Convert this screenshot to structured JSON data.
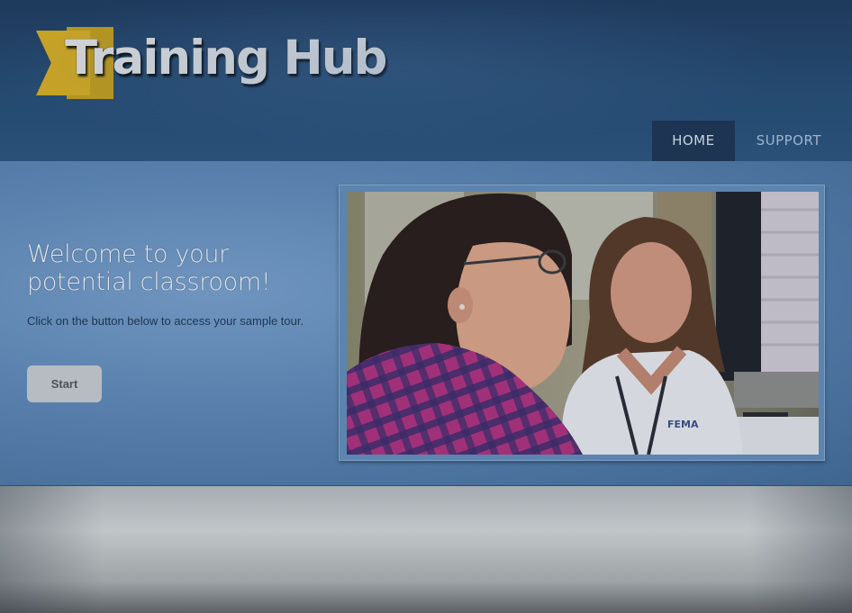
{
  "header": {
    "logo_text": "Training Hub",
    "nav": [
      {
        "label": "HOME",
        "active": true
      },
      {
        "label": "SUPPORT",
        "active": false
      }
    ]
  },
  "hero": {
    "title": "Welcome to your potential classroom!",
    "text": "Click on the button below to access your sample tour.",
    "start_label": "Start",
    "photo_badge": "FEMA"
  },
  "colors": {
    "header_bg": "#25496f",
    "hero_bg": "#5a81ad",
    "logo_accent": "#c9a322",
    "button_bg": "#b6bcc2"
  }
}
